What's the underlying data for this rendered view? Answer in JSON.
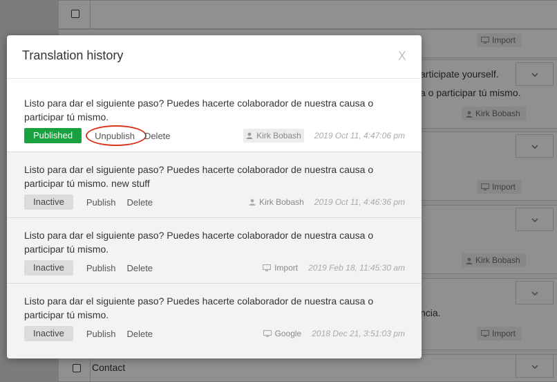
{
  "background": {
    "partial_texts": [
      "articipate yourself.",
      "a o participar tú mismo.",
      "ncia."
    ],
    "badges": [
      {
        "icon": "monitor-icon",
        "label": "Import"
      },
      {
        "icon": "user-icon",
        "label": "Kirk Bobash"
      },
      {
        "icon": "monitor-icon",
        "label": "Import"
      },
      {
        "icon": "user-icon",
        "label": "Kirk Bobash"
      },
      {
        "icon": "monitor-icon",
        "label": "Import"
      }
    ],
    "contact_label": "Contact"
  },
  "modal": {
    "title": "Translation history",
    "close_label": "X",
    "entries": [
      {
        "text": "Listo para dar el siguiente paso? Puedes hacerte colaborador de nuestra causa o participar tú mismo.",
        "status": "Published",
        "status_type": "published",
        "toggle_label": "Unpublish",
        "delete_label": "Delete",
        "source_icon": "user-icon",
        "source": "Kirk Bobash",
        "timestamp": "2019 Oct 11, 4:47:06 pm"
      },
      {
        "text": "Listo para dar el siguiente paso? Puedes hacerte colaborador de nuestra causa o participar tú mismo. new stuff",
        "status": "Inactive",
        "status_type": "inactive",
        "toggle_label": "Publish",
        "delete_label": "Delete",
        "source_icon": "user-icon",
        "source": "Kirk Bobash",
        "timestamp": "2019 Oct 11, 4:46:36 pm"
      },
      {
        "text": "Listo para dar el siguiente paso? Puedes hacerte colaborador de nuestra causa o participar tú mismo.",
        "status": "Inactive",
        "status_type": "inactive",
        "toggle_label": "Publish",
        "delete_label": "Delete",
        "source_icon": "monitor-icon",
        "source": "Import",
        "timestamp": "2019 Feb 18, 11:45:30 am"
      },
      {
        "text": "Listo para dar el siguiente paso? Puedes hacerte colaborador de nuestra causa o participar tú mismo.",
        "status": "Inactive",
        "status_type": "inactive",
        "toggle_label": "Publish",
        "delete_label": "Delete",
        "source_icon": "monitor-icon",
        "source": "Google",
        "timestamp": "2018 Dec 21, 3:51:03 pm"
      }
    ]
  },
  "colors": {
    "published": "#1aa13f",
    "highlight_ring": "#d8321f",
    "inactive_badge": "#dcdcdc"
  }
}
